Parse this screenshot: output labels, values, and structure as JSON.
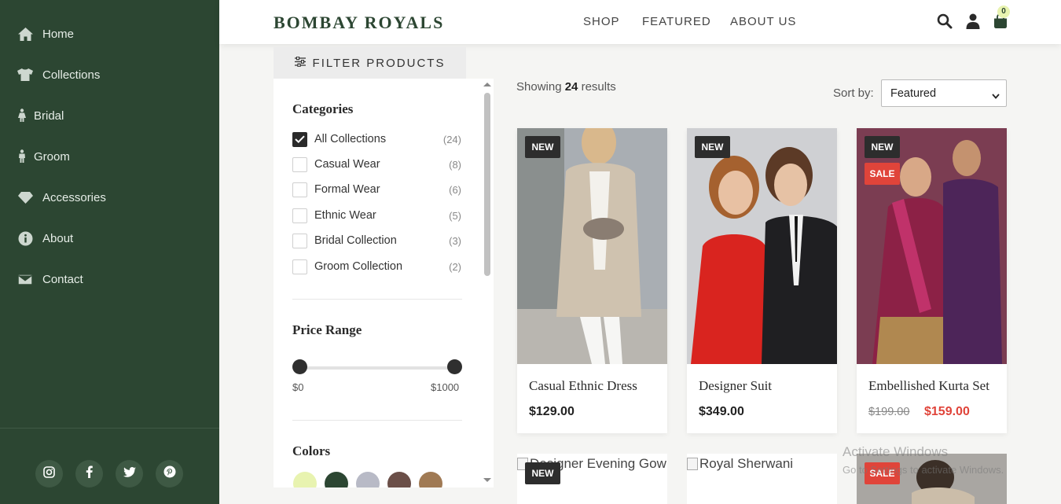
{
  "sidebar": {
    "items": [
      {
        "label": "Home",
        "icon": "home-icon"
      },
      {
        "label": "Collections",
        "icon": "shirt-icon"
      },
      {
        "label": "Bridal",
        "icon": "female-icon"
      },
      {
        "label": "Groom",
        "icon": "male-icon"
      },
      {
        "label": "Accessories",
        "icon": "diamond-icon"
      },
      {
        "label": "About",
        "icon": "info-icon"
      },
      {
        "label": "Contact",
        "icon": "envelope-icon"
      }
    ],
    "social": [
      "instagram-icon",
      "facebook-icon",
      "twitter-icon",
      "pinterest-icon"
    ]
  },
  "header": {
    "brand": "BOMBAY ROYALS",
    "nav": [
      "SHOP",
      "FEATURED",
      "ABOUT US"
    ],
    "cart_count": "0"
  },
  "filter": {
    "button_label": "FILTER PRODUCTS",
    "categories_title": "Categories",
    "categories": [
      {
        "label": "All Collections",
        "count": "(24)",
        "checked": true
      },
      {
        "label": "Casual Wear",
        "count": "(8)",
        "checked": false
      },
      {
        "label": "Formal Wear",
        "count": "(6)",
        "checked": false
      },
      {
        "label": "Ethnic Wear",
        "count": "(5)",
        "checked": false
      },
      {
        "label": "Bridal Collection",
        "count": "(3)",
        "checked": false
      },
      {
        "label": "Groom Collection",
        "count": "(2)",
        "checked": false
      }
    ],
    "price_title": "Price Range",
    "price_min": "$0",
    "price_max": "$1000",
    "colors_title": "Colors",
    "colors": [
      "#e8f3b0",
      "#2c4632",
      "#b8bac6",
      "#6b4f48",
      "#a07a54"
    ]
  },
  "results": {
    "showing_prefix": "Showing",
    "count": "24",
    "suffix": "results",
    "sort_label": "Sort by:",
    "sort_value": "Featured"
  },
  "products": [
    {
      "name": "Casual Ethnic Dress",
      "price": "$129.00",
      "badges": [
        "NEW"
      ]
    },
    {
      "name": "Designer Suit",
      "price": "$349.00",
      "badges": [
        "NEW"
      ]
    },
    {
      "name": "Embellished Kurta Set",
      "old_price": "$199.00",
      "price": "$159.00",
      "badges": [
        "NEW",
        "SALE"
      ]
    }
  ],
  "products_row2": [
    {
      "alt": "Designer Evening Gown",
      "badges": [
        "NEW"
      ]
    },
    {
      "alt": "Royal Sherwani",
      "badges": []
    },
    {
      "alt": "",
      "badges": [
        "SALE"
      ]
    }
  ],
  "watermark": {
    "title": "Activate Windows",
    "subtitle": "Go to Settings to activate Windows."
  },
  "colors": {
    "sidebar": "#2c4632",
    "sale": "#e0443a",
    "badge_new": "#2d2d2d"
  }
}
